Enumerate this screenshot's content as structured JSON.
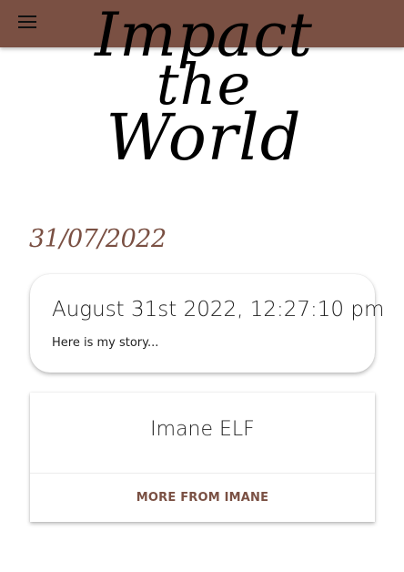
{
  "header": {
    "menu_icon": "hamburger-menu-icon",
    "background_color": "#7a5043"
  },
  "logo": {
    "line1": "Impact",
    "line2": "the",
    "line3": "World"
  },
  "date_heading": "31/07/2022",
  "story": {
    "title": "August 31st 2022, 12:27:10 pm",
    "text": "Here is my story..."
  },
  "author": {
    "name": "Imane ELF",
    "more_label": "MORE FROM IMANE"
  },
  "accent_color": "#7a5043"
}
